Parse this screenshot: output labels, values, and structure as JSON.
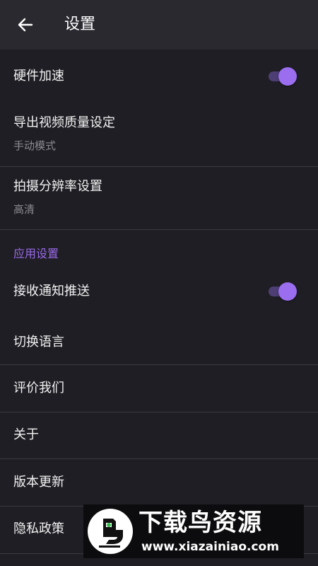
{
  "header": {
    "title": "设置",
    "back_icon": "arrow-left-icon"
  },
  "general": {
    "hardware_acceleration": {
      "label": "硬件加速",
      "enabled": true
    },
    "export_quality": {
      "label": "导出视频质量设定",
      "value": "手动模式"
    },
    "capture_resolution": {
      "label": "拍摄分辨率设置",
      "value": "高清"
    }
  },
  "app_settings": {
    "header": "应用设置",
    "notifications": {
      "label": "接收通知推送",
      "enabled": true
    },
    "language": {
      "label": "切换语言"
    },
    "rate": {
      "label": "评价我们"
    },
    "about": {
      "label": "关于"
    },
    "update": {
      "label": "版本更新"
    },
    "privacy": {
      "label": "隐私政策"
    }
  },
  "watermark": {
    "brand": "下载鸟资源",
    "url": "www.xiazainiao.com"
  },
  "colors": {
    "background": "#1f1e24",
    "app_bar": "#2a2930",
    "accent": "#9b6ef0",
    "toggle_track": "#4d3f73",
    "divider": "#3b3a42",
    "secondary_text": "#8a8a90"
  }
}
